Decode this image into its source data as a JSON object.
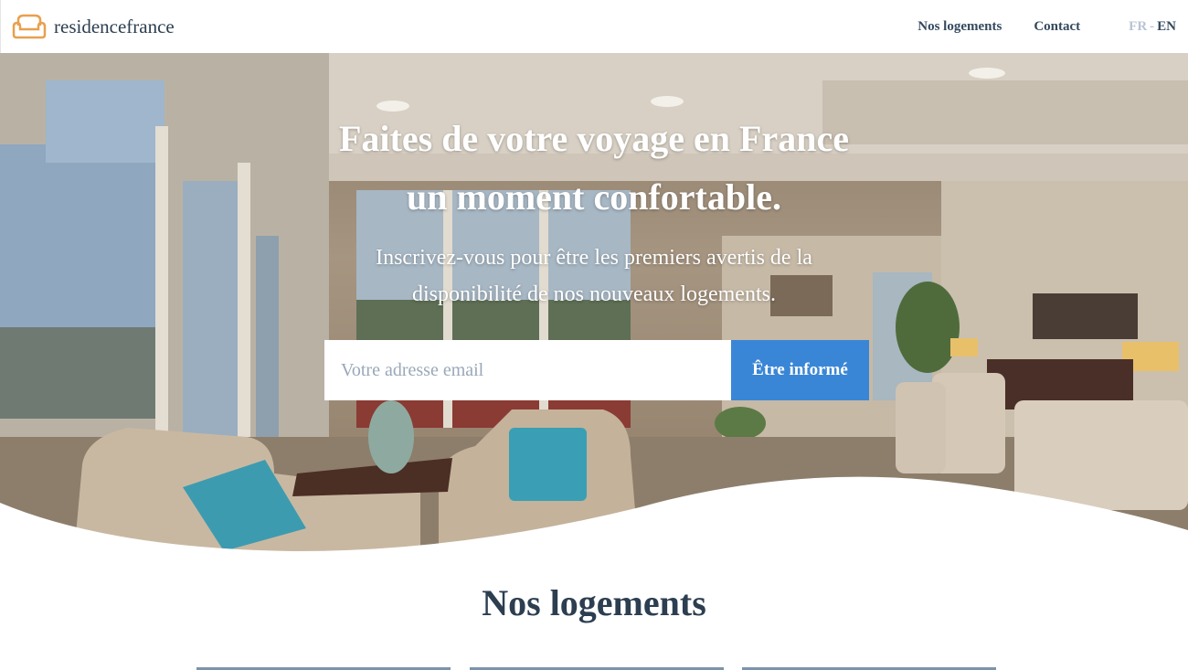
{
  "header": {
    "brand": "residencefrance",
    "nav": [
      {
        "label": "Nos logements"
      },
      {
        "label": "Contact"
      }
    ],
    "lang": {
      "fr": "FR",
      "sep": "-",
      "en": "EN"
    }
  },
  "hero": {
    "title_line1": "Faites de votre voyage en France",
    "title_line2": "un moment confortable.",
    "subtitle_line1": "Inscrivez-vous pour être les premiers avertis de la",
    "subtitle_line2": "disponibilité de nos nouveaux logements.",
    "email_placeholder": "Votre adresse email",
    "email_value": "",
    "cta_label": "Être informé"
  },
  "section": {
    "title": "Nos logements"
  },
  "colors": {
    "brand": "#e8a04f",
    "cta": "#3a86d6",
    "text_dark": "#2c3e50",
    "lang_inactive": "#b8c4d3"
  },
  "icons": {
    "logo": "sofa-icon"
  }
}
